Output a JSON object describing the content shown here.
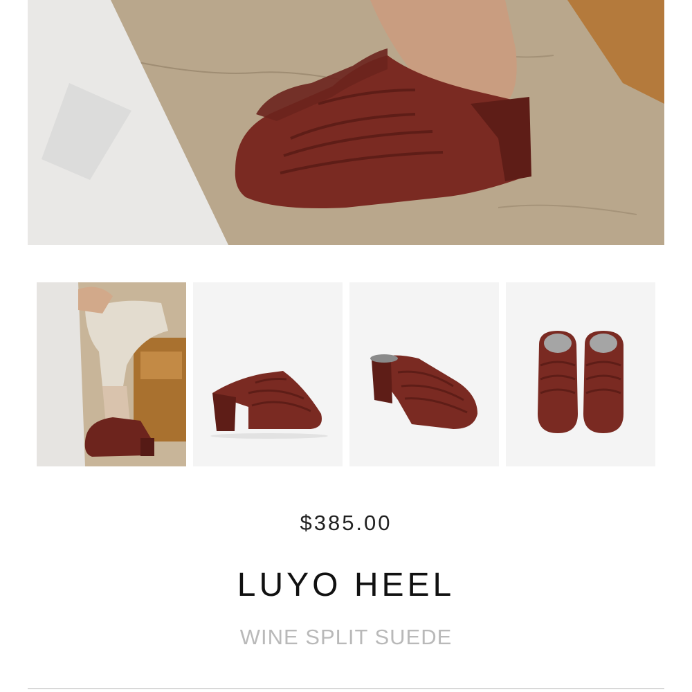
{
  "product": {
    "price": "$385.00",
    "name": "LUYO HEEL",
    "color_name": "WINE SPLIT SUEDE"
  },
  "gallery": {
    "hero_image": "model-wearing-mule-closeup",
    "thumbnails": [
      {
        "image": "model-seated-lifestyle",
        "selected": true
      },
      {
        "image": "shoe-side-profile",
        "selected": false
      },
      {
        "image": "shoe-three-quarter-view",
        "selected": false
      },
      {
        "image": "shoe-pair-top-view",
        "selected": false
      }
    ]
  },
  "colors": {
    "suede": "#7a2a22",
    "suede_dark": "#5e1d17",
    "floor": "#b7a487",
    "price_text": "#222222",
    "subtitle_text": "#b9b9b9"
  }
}
